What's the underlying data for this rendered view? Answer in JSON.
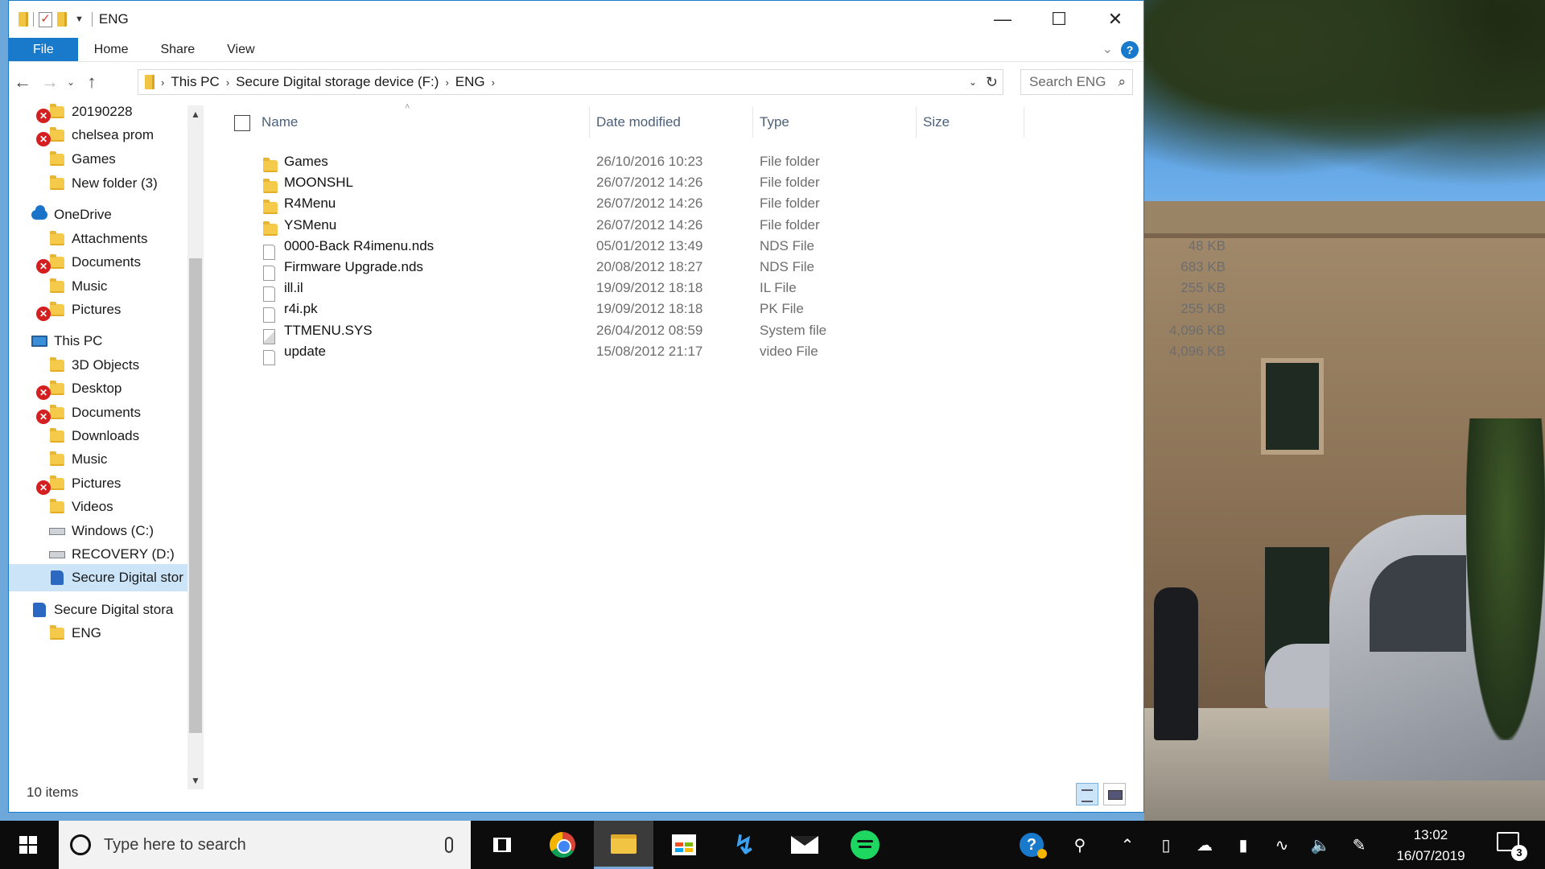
{
  "window": {
    "title": "ENG",
    "minimize": "—",
    "maximize": "☐",
    "close": "✕"
  },
  "ribbon": {
    "tabs": [
      "File",
      "Home",
      "Share",
      "View"
    ],
    "expand_icon": "chevron-down-icon",
    "help_label": "?"
  },
  "address": {
    "back": "←",
    "forward": "→",
    "recent": "⌄",
    "up": "↑",
    "breadcrumb": [
      "This PC",
      "Secure Digital storage device (F:)",
      "ENG"
    ],
    "separator": "›",
    "dropdown": "⌄",
    "refresh": "↻"
  },
  "search": {
    "placeholder": "Search ENG",
    "icon": "⌕"
  },
  "nav": {
    "items": [
      {
        "label": "20190228",
        "icon": "folder-icon",
        "error": true
      },
      {
        "label": "chelsea prom",
        "icon": "folder-icon",
        "error": true
      },
      {
        "label": "Games",
        "icon": "folder-icon",
        "error": false
      },
      {
        "label": "New folder (3)",
        "icon": "folder-icon",
        "error": false
      },
      {
        "label": "OneDrive",
        "icon": "cloud-icon",
        "error": false
      },
      {
        "label": "Attachments",
        "icon": "folder-icon",
        "error": false
      },
      {
        "label": "Documents",
        "icon": "documents-icon",
        "error": true
      },
      {
        "label": "Music",
        "icon": "folder-icon",
        "error": false
      },
      {
        "label": "Pictures",
        "icon": "pictures-icon",
        "error": true
      },
      {
        "label": "This PC",
        "icon": "computer-icon",
        "error": false
      },
      {
        "label": "3D Objects",
        "icon": "cube-icon",
        "error": false
      },
      {
        "label": "Desktop",
        "icon": "desktop-icon",
        "error": true
      },
      {
        "label": "Documents",
        "icon": "documents-icon",
        "error": true
      },
      {
        "label": "Downloads",
        "icon": "downloads-icon",
        "error": false
      },
      {
        "label": "Music",
        "icon": "music-icon",
        "error": false
      },
      {
        "label": "Pictures",
        "icon": "pictures-icon",
        "error": true
      },
      {
        "label": "Videos",
        "icon": "videos-icon",
        "error": false
      },
      {
        "label": "Windows (C:)",
        "icon": "drive-icon",
        "error": false
      },
      {
        "label": "RECOVERY (D:)",
        "icon": "drive-icon",
        "error": false
      },
      {
        "label": "Secure Digital stor",
        "icon": "sd-card-icon",
        "error": false,
        "selected": true
      },
      {
        "label": "Secure Digital stora",
        "icon": "sd-card-icon",
        "error": false
      },
      {
        "label": "ENG",
        "icon": "folder-icon",
        "error": false
      }
    ],
    "error_glyph": "✕"
  },
  "columns": {
    "name": "Name",
    "date": "Date modified",
    "type": "Type",
    "size": "Size",
    "sort_indicator": "˄"
  },
  "files": [
    {
      "name": "Games",
      "date": "26/10/2016 10:23",
      "type": "File folder",
      "size": "",
      "icon": "folder-icon"
    },
    {
      "name": "MOONSHL",
      "date": "26/07/2012 14:26",
      "type": "File folder",
      "size": "",
      "icon": "folder-icon"
    },
    {
      "name": "R4Menu",
      "date": "26/07/2012 14:26",
      "type": "File folder",
      "size": "",
      "icon": "folder-icon"
    },
    {
      "name": "YSMenu",
      "date": "26/07/2012 14:26",
      "type": "File folder",
      "size": "",
      "icon": "folder-icon"
    },
    {
      "name": "0000-Back R4imenu.nds",
      "date": "05/01/2012 13:49",
      "type": "NDS File",
      "size": "48 KB",
      "icon": "file-icon"
    },
    {
      "name": "Firmware Upgrade.nds",
      "date": "20/08/2012 18:27",
      "type": "NDS File",
      "size": "683 KB",
      "icon": "file-icon"
    },
    {
      "name": "ill.il",
      "date": "19/09/2012 18:18",
      "type": "IL File",
      "size": "255 KB",
      "icon": "file-icon"
    },
    {
      "name": "r4i.pk",
      "date": "19/09/2012 18:18",
      "type": "PK File",
      "size": "255 KB",
      "icon": "file-icon"
    },
    {
      "name": "TTMENU.SYS",
      "date": "26/04/2012 08:59",
      "type": "System file",
      "size": "4,096 KB",
      "icon": "system-file-icon"
    },
    {
      "name": "update",
      "date": "15/08/2012 21:17",
      "type": "video File",
      "size": "4,096 KB",
      "icon": "file-icon"
    }
  ],
  "status": {
    "count": "10 items"
  },
  "taskbar": {
    "search_placeholder": "Type here to search",
    "time": "13:02",
    "date": "16/07/2019",
    "notifications": "3",
    "help_glyph": "?"
  },
  "colors": {
    "accent": "#1979ca",
    "error": "#d41e20",
    "selected": "#cce4f7"
  }
}
